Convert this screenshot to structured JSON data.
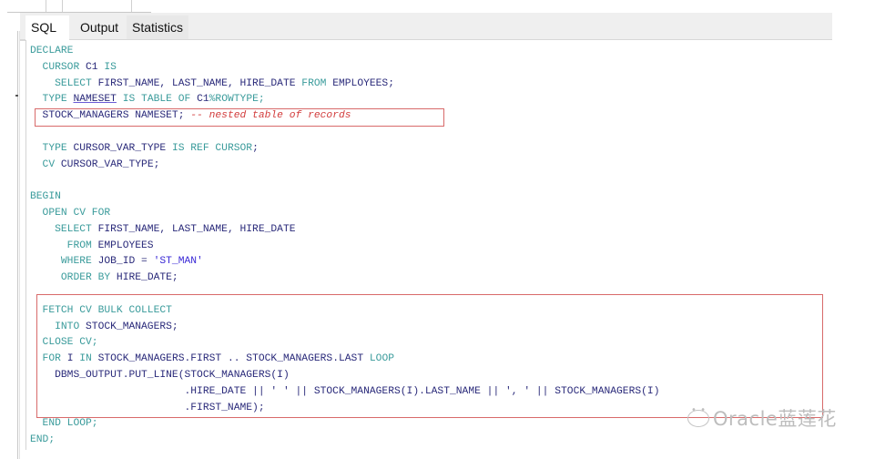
{
  "tabs": [
    {
      "label": "SQL",
      "active": true
    },
    {
      "label": "Output",
      "active": false
    },
    {
      "label": "Statistics",
      "active": false
    }
  ],
  "code_lines": [
    [
      {
        "t": "DECLARE",
        "c": "kw"
      }
    ],
    [
      {
        "t": "  CURSOR ",
        "c": "kw"
      },
      {
        "t": "C1 ",
        "c": "id"
      },
      {
        "t": "IS",
        "c": "kw"
      }
    ],
    [
      {
        "t": "    SELECT ",
        "c": "kw"
      },
      {
        "t": "FIRST_NAME, LAST_NAME, HIRE_DATE ",
        "c": "id"
      },
      {
        "t": "FROM ",
        "c": "kw"
      },
      {
        "t": "EMPLOYEES;",
        "c": "id"
      }
    ],
    [
      {
        "t": "  TYPE ",
        "c": "kw"
      },
      {
        "t": "NAMESET",
        "c": "id ul"
      },
      {
        "t": " IS TABLE OF ",
        "c": "kw"
      },
      {
        "t": "C1",
        "c": "id"
      },
      {
        "t": "%ROWTYPE;",
        "c": "kw"
      }
    ],
    [
      {
        "t": "  STOCK_MANAGERS NAMESET; ",
        "c": "id"
      },
      {
        "t": "-- nested table of records",
        "c": "cmt"
      }
    ],
    [
      {
        "t": "",
        "c": "id"
      }
    ],
    [
      {
        "t": "  TYPE ",
        "c": "kw"
      },
      {
        "t": "CURSOR_VAR_TYPE ",
        "c": "id"
      },
      {
        "t": "IS REF CURSOR",
        "c": "kw"
      },
      {
        "t": ";",
        "c": "id"
      }
    ],
    [
      {
        "t": "  CV ",
        "c": "kw"
      },
      {
        "t": "CURSOR_VAR_TYPE;",
        "c": "id"
      }
    ],
    [
      {
        "t": "",
        "c": "id"
      }
    ],
    [
      {
        "t": "BEGIN",
        "c": "kw"
      }
    ],
    [
      {
        "t": "  OPEN CV FOR",
        "c": "kw"
      }
    ],
    [
      {
        "t": "    SELECT ",
        "c": "kw"
      },
      {
        "t": "FIRST_NAME, LAST_NAME, HIRE_DATE",
        "c": "id"
      }
    ],
    [
      {
        "t": "      FROM ",
        "c": "kw"
      },
      {
        "t": "EMPLOYEES",
        "c": "id"
      }
    ],
    [
      {
        "t": "     WHERE ",
        "c": "kw"
      },
      {
        "t": "JOB_ID = ",
        "c": "id"
      },
      {
        "t": "'ST_MAN'",
        "c": "str"
      }
    ],
    [
      {
        "t": "     ORDER BY ",
        "c": "kw"
      },
      {
        "t": "HIRE_DATE;",
        "c": "id"
      }
    ],
    [
      {
        "t": "",
        "c": "id"
      }
    ],
    [
      {
        "t": "  FETCH CV BULK COLLECT",
        "c": "kw"
      }
    ],
    [
      {
        "t": "    INTO ",
        "c": "kw"
      },
      {
        "t": "STOCK_MANAGERS;",
        "c": "id"
      }
    ],
    [
      {
        "t": "  CLOSE CV;",
        "c": "kw"
      }
    ],
    [
      {
        "t": "  FOR ",
        "c": "kw"
      },
      {
        "t": "I ",
        "c": "id"
      },
      {
        "t": "IN ",
        "c": "kw"
      },
      {
        "t": "STOCK_MANAGERS.FIRST .. STOCK_MANAGERS.LAST ",
        "c": "id"
      },
      {
        "t": "LOOP",
        "c": "kw"
      }
    ],
    [
      {
        "t": "    DBMS_OUTPUT.PUT_LINE(STOCK_MANAGERS(I)",
        "c": "id"
      }
    ],
    [
      {
        "t": "                         .HIRE_DATE || ' ' || STOCK_MANAGERS(I).LAST_NAME || ', ' || STOCK_MANAGERS(I)",
        "c": "id"
      }
    ],
    [
      {
        "t": "                         .FIRST_NAME);",
        "c": "id"
      }
    ],
    [
      {
        "t": "  END LOOP;",
        "c": "kw"
      }
    ],
    [
      {
        "t": "END;",
        "c": "kw"
      }
    ]
  ],
  "watermark": "Oracle蓝莲花",
  "colors": {
    "keyword": "#3a9b9b",
    "identifier": "#2a2a7a",
    "string": "#3b2ad6",
    "comment": "#d23c3c",
    "highlight_box": "#d86a6a"
  }
}
